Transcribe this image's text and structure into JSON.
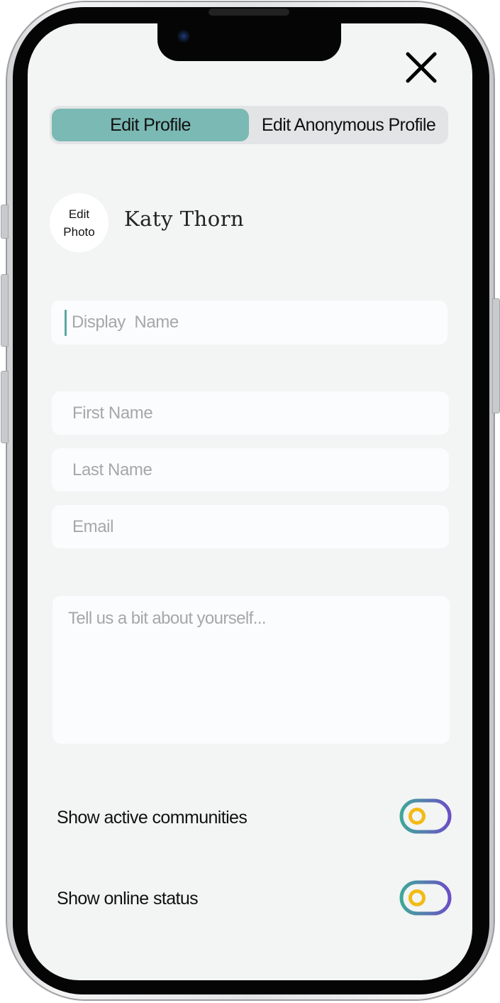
{
  "header": {
    "close_icon": "close-icon"
  },
  "tabs": [
    {
      "label": "Edit Profile",
      "active": true
    },
    {
      "label": "Edit Anonymous Profile",
      "active": false
    }
  ],
  "profile": {
    "photo_label_line1": "Edit",
    "photo_label_line2": "Photo",
    "name": "Katy Thorn"
  },
  "form": {
    "display_name": {
      "value": "",
      "placeholder": "Display  Name"
    },
    "first_name": {
      "value": "",
      "placeholder": "First Name"
    },
    "last_name": {
      "value": "",
      "placeholder": "Last Name"
    },
    "email": {
      "value": "",
      "placeholder": "Email"
    },
    "bio": {
      "value": "",
      "placeholder": "Tell us a bit about yourself..."
    }
  },
  "toggles": [
    {
      "label": "Show active communities",
      "on": false
    },
    {
      "label": "Show online status",
      "on": false
    }
  ],
  "colors": {
    "accent": "#7bb9b4",
    "toggle_teal": "#3fa79a",
    "toggle_purple": "#6a4fc5",
    "toggle_knob": "#f2bb15"
  }
}
